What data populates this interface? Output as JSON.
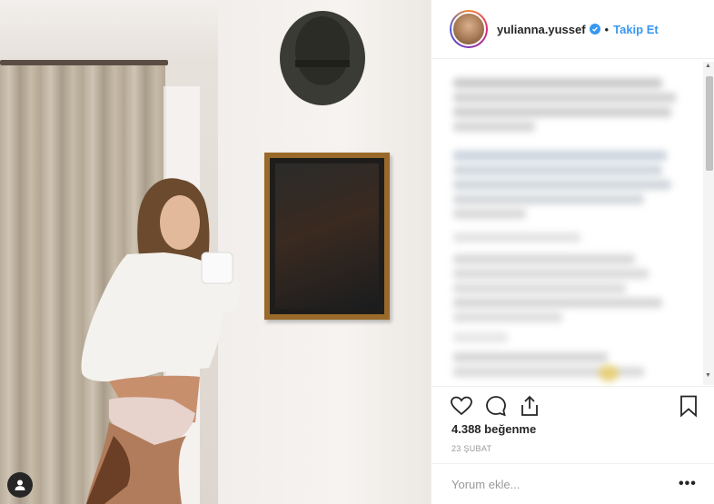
{
  "header": {
    "username": "yulianna.yussef",
    "separator": "•",
    "follow_label": "Takip Et"
  },
  "post": {
    "likes_text": "4.388 beğenme",
    "date_text": "23 ŞUBAT"
  },
  "comment_box": {
    "placeholder": "Yorum ekle...",
    "more_label": "•••"
  },
  "icons": {
    "like": "heart-icon",
    "comment": "comment-icon",
    "share": "share-icon",
    "save": "bookmark-icon",
    "verified": "verified-badge-icon",
    "user": "user-icon"
  },
  "colors": {
    "link": "#3897f0",
    "text": "#262626",
    "muted": "#999999"
  }
}
